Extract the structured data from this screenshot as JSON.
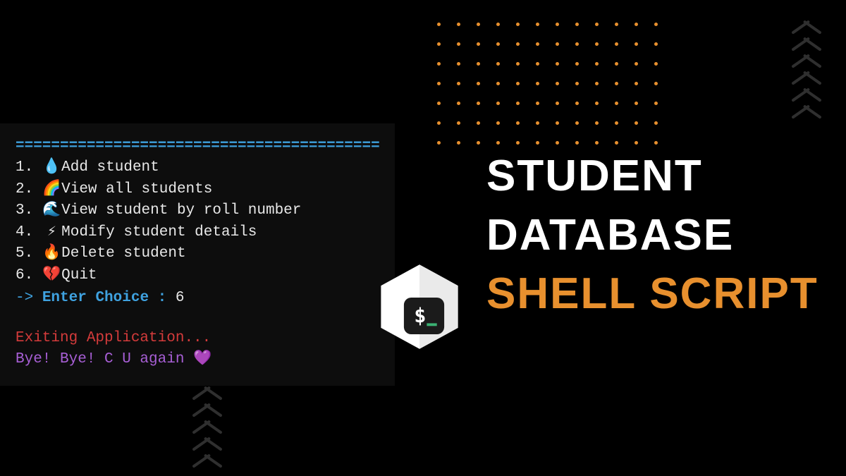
{
  "terminal": {
    "divider": "=====================================================",
    "menu": [
      {
        "num": "1.",
        "icon": "💧",
        "label": "Add student"
      },
      {
        "num": "2.",
        "icon": "🌈",
        "label": "View all students"
      },
      {
        "num": "3.",
        "icon": "🌊",
        "label": "View student by roll number"
      },
      {
        "num": "4.",
        "icon": "⚡",
        "label": "Modify student details"
      },
      {
        "num": "5.",
        "icon": "🔥",
        "label": "Delete student"
      },
      {
        "num": "6.",
        "icon": "💔",
        "label": "Quit"
      }
    ],
    "prompt_arrow": "->",
    "prompt_label": "Enter Choice :",
    "choice_value": "6",
    "exit_message": "Exiting Application...",
    "bye_message": "Bye! Bye! C U again",
    "bye_heart": "💜"
  },
  "title": {
    "line1": "STUDENT",
    "line2": "DATABASE",
    "line3": "SHELL SCRIPT"
  },
  "colors": {
    "accent_orange": "#e8902e",
    "terminal_blue": "#3fa2e0",
    "exit_red": "#d43b3b",
    "bye_purple": "#a85fd6"
  }
}
